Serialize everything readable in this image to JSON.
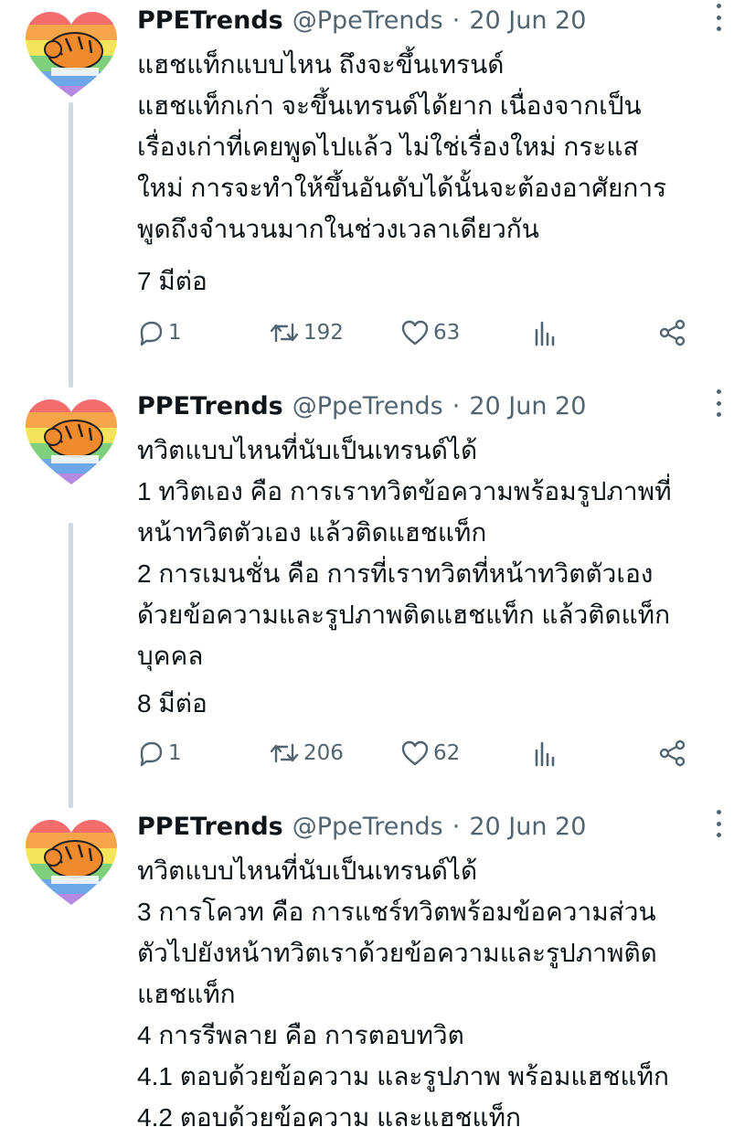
{
  "tweets": [
    {
      "name": "PPETrends",
      "handle": "@PpeTrends",
      "separator": "·",
      "date": "20 Jun 20",
      "lines": [
        "แฮชแท็กแบบไหน ถึงจะขึ้นเทรนด์",
        "แฮชแท็กเก่า  จะขึ้นเทรนด์ได้ยาก เนื่องจากเป็น",
        "เรื่องเก่าที่เคยพูดไปแล้ว ไม่ใช่เรื่องใหม่ กระแส",
        "ใหม่ การจะทำให้ขึ้นอันดับได้นั้นจะต้องอาศัยการ",
        "พูดถึงจำนวนมากในช่วงเวลาเดียวกัน"
      ],
      "more": "7 มีต่อ",
      "replies": "1",
      "retweets": "192",
      "likes": "63"
    },
    {
      "name": "PPETrends",
      "handle": "@PpeTrends",
      "separator": "·",
      "date": "20 Jun 20",
      "lines": [
        "ทวิตแบบไหนที่นับเป็นเทรนด์ได้",
        "1 ทวิตเอง คือ การเราทวิตข้อความพร้อมรูปภาพที่",
        "หน้าทวิตตัวเอง แล้วติดแฮชแท็ก",
        "2 การเมนชั่น คือ การที่เราทวิตที่หน้าทวิตตัวเอง",
        "ด้วยข้อความและรูปภาพติดแฮชแท็ก แล้วติดแท็ก",
        "บุคคล"
      ],
      "more": "8 มีต่อ",
      "replies": "1",
      "retweets": "206",
      "likes": "62"
    },
    {
      "name": "PPETrends",
      "handle": "@PpeTrends",
      "separator": "·",
      "date": "20 Jun 20",
      "lines": [
        "ทวิตแบบไหนที่นับเป็นเทรนด์ได้",
        "3 การโควท คือ การแชร์ทวิตพร้อมข้อความส่วน",
        "ตัวไปยังหน้าทวิตเราด้วยข้อความและรูปภาพติด",
        "แฮชแท็ก",
        "4 การรีพลาย คือ การตอบทวิต",
        "4.1 ตอบด้วยข้อความ และรูปภาพ พร้อมแฮชแท็ก",
        "4.2 ตอบด้วยข้อความ และแฮชแท็ก"
      ]
    }
  ],
  "avatar_text": "PPE TRENDS",
  "icons": {
    "reply": "reply-icon",
    "retweet": "retweet-icon",
    "like": "heart-icon",
    "views": "analytics-icon",
    "share": "share-icon",
    "more": "more-icon"
  },
  "colors": {
    "text": "#0f1419",
    "secondary": "#536471",
    "thread_line": "#cfd9de",
    "background": "#ffffff"
  }
}
